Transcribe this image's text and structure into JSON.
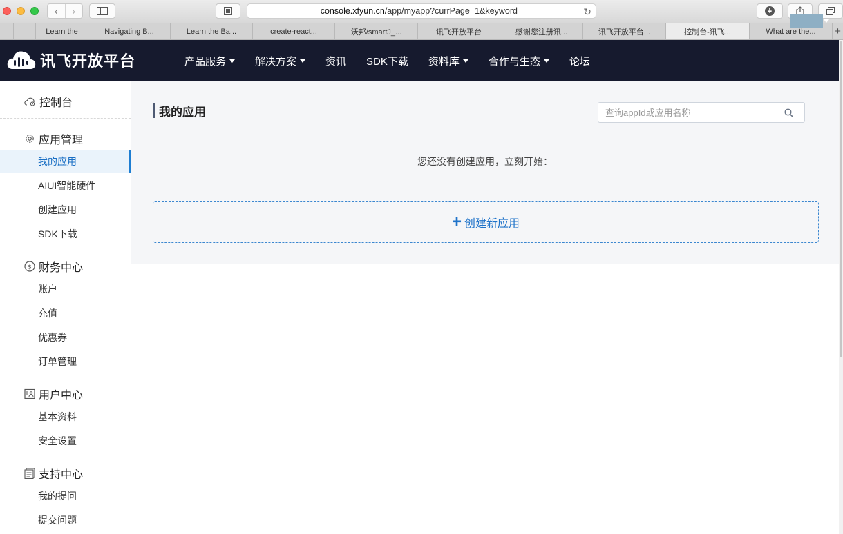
{
  "browser": {
    "url_domain": "console.xfyun.cn",
    "url_path": "/app/myapp?currPage=1&keyword=",
    "tabs": [
      {
        "label": ""
      },
      {
        "label": "Learn the"
      },
      {
        "label": "Navigating B..."
      },
      {
        "label": "Learn the Ba..."
      },
      {
        "label": "create-react..."
      },
      {
        "label": "沃邦/smartJ_..."
      },
      {
        "label": "讯飞开放平台"
      },
      {
        "label": "感谢您注册讯..."
      },
      {
        "label": "讯飞开放平台..."
      },
      {
        "label": "控制台-讯飞..."
      },
      {
        "label": "What are the..."
      }
    ]
  },
  "header": {
    "logo_text": "讯飞开放平台",
    "nav": [
      {
        "label": "产品服务",
        "has_caret": true
      },
      {
        "label": "解决方案",
        "has_caret": true
      },
      {
        "label": "资讯",
        "has_caret": false
      },
      {
        "label": "SDK下载",
        "has_caret": false
      },
      {
        "label": "资料库",
        "has_caret": true
      },
      {
        "label": "合作与生态",
        "has_caret": true
      },
      {
        "label": "论坛",
        "has_caret": false
      }
    ]
  },
  "sidebar": {
    "console_label": "控制台",
    "groups": [
      {
        "title": "应用管理",
        "icon": "gear-icon",
        "items": [
          "我的应用",
          "AIUI智能硬件",
          "创建应用",
          "SDK下载"
        ]
      },
      {
        "title": "财务中心",
        "icon": "coin-icon",
        "items": [
          "账户",
          "充值",
          "优惠券",
          "订单管理"
        ]
      },
      {
        "title": "用户中心",
        "icon": "id-card-icon",
        "items": [
          "基本资料",
          "安全设置"
        ]
      },
      {
        "title": "支持中心",
        "icon": "document-icon",
        "items": [
          "我的提问",
          "提交问题"
        ]
      }
    ],
    "active_item": "我的应用"
  },
  "main": {
    "title": "我的应用",
    "search_placeholder": "查询appId或应用名称",
    "search_value": "",
    "empty_hint": "您还没有创建应用，立刻开始：",
    "create_label": "创建新应用"
  },
  "colors": {
    "header_bg": "#161a2e",
    "accent": "#1f73c9",
    "active_bg": "#eaf3fb"
  }
}
